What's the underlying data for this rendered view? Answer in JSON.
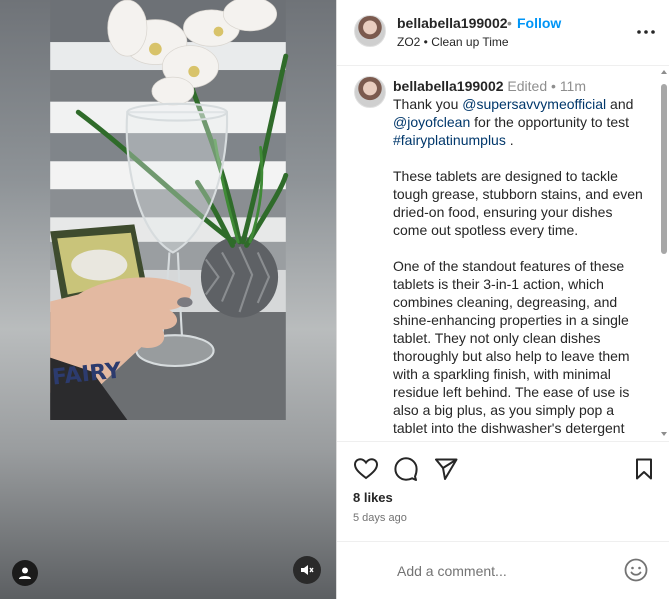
{
  "post": {
    "username": "bellabella199002",
    "separator": "•",
    "follow_label": "Follow",
    "subtitle": "ZO2 • Clean up Time"
  },
  "caption": {
    "username": "bellabella199002",
    "edited": "Edited",
    "dot": "•",
    "time": "11m",
    "intro_1": "Thank you ",
    "mention_1": "@supersavvymeofficial",
    "intro_2": " and ",
    "mention_2": "@joyofclean",
    "intro_3": " for the opportunity to test ",
    "hashtag": "#fairyplatinumplus",
    "intro_4": " .",
    "paragraph_2": "These tablets are designed to tackle tough grease, stubborn stains, and even dried-on food, ensuring your dishes come out spotless every time.",
    "paragraph_3": "One of the standout features of these tablets is their 3-in-1 action, which combines cleaning, degreasing, and shine-enhancing properties in a single tablet. They not only clean dishes thoroughly but also help to leave them with a sparkling finish, with minimal residue left behind. The ease of use is also a big plus, as you simply pop a tablet into the dishwasher's detergent compartment and let it work its magic."
  },
  "engagement": {
    "likes": "8 likes",
    "timestamp": "5 days ago"
  },
  "comment": {
    "placeholder": "Add a comment..."
  },
  "media": {
    "product_label": "FAIRY"
  },
  "icons": {
    "more": "more-options-icon",
    "like": "heart-icon",
    "comment": "comment-bubble-icon",
    "share": "paper-plane-icon",
    "save": "bookmark-icon",
    "emoji": "emoji-icon",
    "mute": "muted-speaker-icon",
    "tagged": "user-tag-icon"
  },
  "colors": {
    "link": "#00376b",
    "follow": "#0095f6",
    "muted_text": "#737373"
  }
}
